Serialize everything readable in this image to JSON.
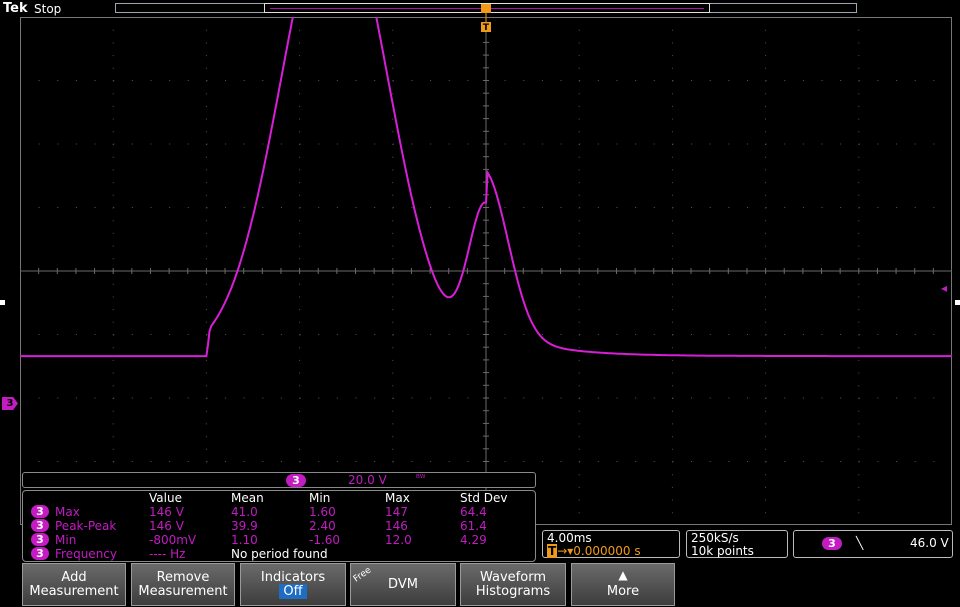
{
  "header": {
    "brand": "Tek",
    "status": "Stop",
    "trigger_marker": "T"
  },
  "channel": {
    "number": "3",
    "scale": "20.0 V",
    "bw_symbol": "ᴮᵂ",
    "color": "#c21cc2"
  },
  "measurements": {
    "headers": [
      "Value",
      "Mean",
      "Min",
      "Max",
      "Std Dev"
    ],
    "rows": [
      {
        "ch": "3",
        "name": "Max",
        "value": "146 V",
        "mean": "41.0",
        "min": "1.60",
        "max": "147",
        "std": "64.4"
      },
      {
        "ch": "3",
        "name": "Peak-Peak",
        "value": "146 V",
        "mean": "39.9",
        "min": "2.40",
        "max": "146",
        "std": "61.4"
      },
      {
        "ch": "3",
        "name": "Min",
        "value": "-800mV",
        "mean": "1.10",
        "min": "-1.60",
        "max": "12.0",
        "std": "4.29"
      },
      {
        "ch": "3",
        "name": "Frequency",
        "value": "---- Hz",
        "mean": "No period found",
        "min": "",
        "max": "",
        "std": ""
      }
    ]
  },
  "timebase": {
    "scale": "4.00ms",
    "position": "0.000000 s",
    "trig_icon": "T"
  },
  "acquisition": {
    "rate": "250kS/s",
    "points": "10k points"
  },
  "trigger": {
    "channel": "3",
    "slope_icon": "falling-edge-icon",
    "level": "46.0 V"
  },
  "menu": {
    "add_1": "Add",
    "add_2": "Measurement",
    "remove_1": "Remove",
    "remove_2": "Measurement",
    "indicators_1": "Indicators",
    "indicators_2": "Off",
    "dvm_tag": "Free",
    "dvm": "DVM",
    "hist_1": "Waveform",
    "hist_2": "Histograms",
    "more_icon": "up-arrow-icon",
    "more": "More"
  },
  "waveform": {
    "x_range_ms": [
      -20,
      20
    ],
    "y_range_V": [
      -100,
      100
    ],
    "baseline_V": -0.8,
    "offset_div": -1.3,
    "peaks": [
      {
        "t_ms": -6.5,
        "v": 146
      },
      {
        "t_ms": 0.0,
        "v": 52
      }
    ]
  }
}
